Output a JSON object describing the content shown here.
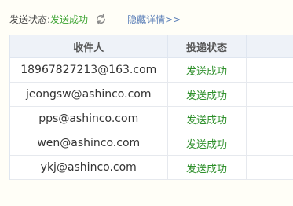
{
  "send_status": {
    "label": "发送状态:",
    "value": "发送成功",
    "refresh_icon": "refresh-icon",
    "toggle_details": "隐藏详情>>"
  },
  "table": {
    "headers": {
      "recipient": "收件人",
      "status": "投递状态",
      "extra": ""
    },
    "rows": [
      {
        "email": "18967827213@163.com",
        "status": "发送成功"
      },
      {
        "email": "jeongsw@ashinco.com",
        "status": "发送成功"
      },
      {
        "email": "pps@ashinco.com",
        "status": "发送成功"
      },
      {
        "email": "wen@ashinco.com",
        "status": "发送成功"
      },
      {
        "email": "ykj@ashinco.com",
        "status": "发送成功"
      }
    ]
  },
  "colors": {
    "success": "#3fa535",
    "link": "#5b7fb8",
    "header_bg": "#eef2f8"
  }
}
